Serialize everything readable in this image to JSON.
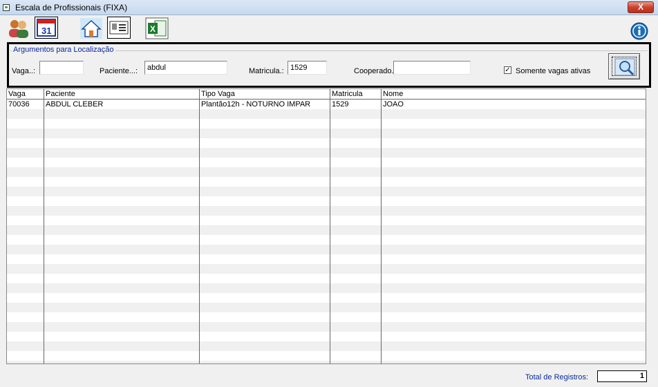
{
  "window": {
    "title": "Escala de Profissionais (FIXA)",
    "close_label": "X"
  },
  "toolbar": {
    "buttons": [
      {
        "icon": "users-icon"
      },
      {
        "icon": "calendar-icon",
        "label": "31"
      },
      {
        "icon": "home-icon"
      },
      {
        "icon": "id-card-icon"
      },
      {
        "icon": "excel-icon"
      }
    ],
    "info_icon": "info-icon"
  },
  "search": {
    "legend": "Argumentos para Localização",
    "vaga_label": "Vaga..:",
    "vaga_value": "",
    "paciente_label": "Paciente...:",
    "paciente_value": "abdul",
    "matricula_label": "Matricula.:",
    "matricula_value": "1529",
    "cooperado_label": "Cooperado.",
    "cooperado_value": "",
    "checkbox_label": "Somente vagas ativas",
    "checkbox_checked": "✓"
  },
  "grid": {
    "columns": [
      "Vaga",
      "Paciente",
      "Tipo Vaga",
      "Matricula",
      "Nome"
    ],
    "rows": [
      [
        "70036",
        "ABDUL CLEBER",
        "Plantão12h - NOTURNO IMPAR",
        "1529",
        "JOAO"
      ]
    ]
  },
  "footer": {
    "total_label": "Total de Registros:",
    "total_value": "1"
  }
}
